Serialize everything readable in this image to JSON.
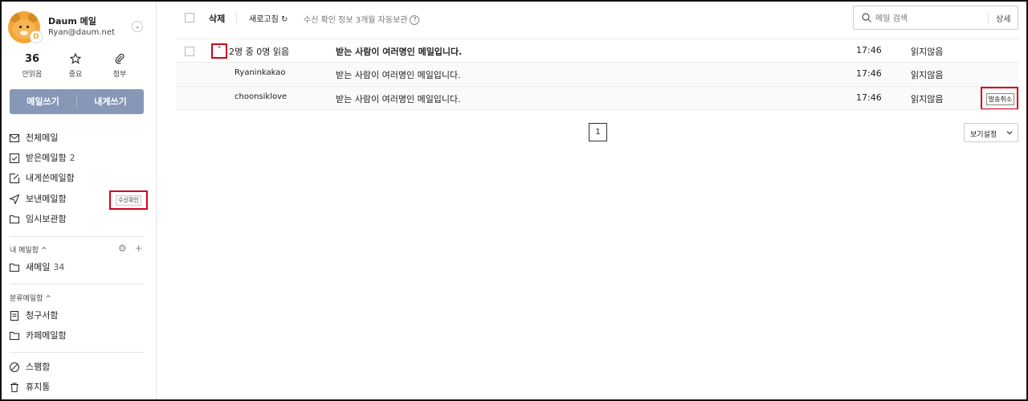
{
  "profile": {
    "name": "Daum 메일",
    "email": "Ryan@daum.net",
    "badge": "D"
  },
  "stats": {
    "unread_count": "36",
    "unread_label": "안읽음",
    "important_label": "중요",
    "attach_label": "첨부"
  },
  "compose": {
    "write_label": "메일쓰기",
    "self_write_label": "내게쓰기"
  },
  "nav": {
    "items": [
      {
        "label": "전체메일",
        "count": "",
        "icon": "mail-icon"
      },
      {
        "label": "받은메일함",
        "count": "2",
        "icon": "inbox-check-icon"
      },
      {
        "label": "내게쓴메일함",
        "count": "",
        "icon": "edit-icon"
      },
      {
        "label": "보낸메일함",
        "count": "",
        "icon": "send-icon"
      },
      {
        "label": "임시보관함",
        "count": "",
        "icon": "folder-icon"
      }
    ],
    "receipt_check_label": "수신확인"
  },
  "my_mailboxes": {
    "title": "내 메일함",
    "items": [
      {
        "label": "새메일",
        "count": "34",
        "icon": "folder-icon"
      }
    ]
  },
  "categories": {
    "title": "분류메일함",
    "items": [
      {
        "label": "청구서함",
        "icon": "bill-icon"
      },
      {
        "label": "카페메일함",
        "icon": "folder-icon"
      }
    ]
  },
  "extra_nav": {
    "items": [
      {
        "label": "스팸함",
        "icon": "block-icon"
      },
      {
        "label": "휴지통",
        "icon": "trash-icon"
      }
    ]
  },
  "toolbar": {
    "delete_label": "삭제",
    "refresh_label": "새로고침",
    "info_text": "수신 확인 정보 3개월 자동보관",
    "help": "?"
  },
  "search": {
    "placeholder": "메일 검색",
    "detail_label": "상세"
  },
  "mail_list": {
    "summary": {
      "read_status": "2명 중 0명 읽음",
      "subject": "받는 사람이 여러명인 메일입니다.",
      "time": "17:46",
      "status": "읽지않음"
    },
    "recipients": [
      {
        "name": "Ryaninkakao",
        "subject": "받는 사람이 여러명인 메일입니다.",
        "time": "17:46",
        "status": "읽지않음",
        "action": ""
      },
      {
        "name": "choonsiklove",
        "subject": "받는 사람이 여러명인 메일입니다.",
        "time": "17:46",
        "status": "읽지않음",
        "action": "발송취소"
      }
    ]
  },
  "pagination": {
    "current": "1"
  },
  "view_settings": {
    "label": "보기설정"
  },
  "colors": {
    "accent": "#8797b8",
    "highlight": "#d0021b"
  }
}
